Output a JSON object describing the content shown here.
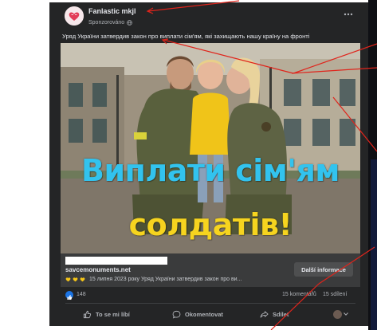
{
  "post": {
    "page_name": "Fanlastic mkjl",
    "sponsored_label": "Sponzorováno",
    "text": "Уряд України затвердив закон про виплати сім'ям, які захищають нашу країну на фронті",
    "image_headline_line1": "Виплати сім'ям",
    "image_headline_line2": "солдатів!",
    "link": {
      "title": "savcemonuments.net",
      "description": "15 липня 2023 року Уряд України затвердив закон про ви...",
      "button_label": "Další informace"
    },
    "stats": {
      "reactions": "148",
      "comments": "15 komentářů",
      "shares": "15 sdílení"
    },
    "actions": {
      "like": "To se mi líbí",
      "comment": "Okomentovat",
      "share": "Sdílet"
    }
  },
  "colors": {
    "post_bg": "#242526",
    "headline_blue": "#32c3ee",
    "headline_yellow": "#f6d41f",
    "annotation_red": "#e0241b",
    "like_blue": "#1b74e4"
  },
  "icons": {
    "avatar": "heart-logo-icon",
    "privacy": "globe-icon",
    "more": "more-dots-icon",
    "reaction": "like-icon",
    "action_like": "thumbs-up-icon",
    "action_comment": "comment-icon",
    "action_share": "share-icon",
    "audience": "chevron-down-icon"
  }
}
